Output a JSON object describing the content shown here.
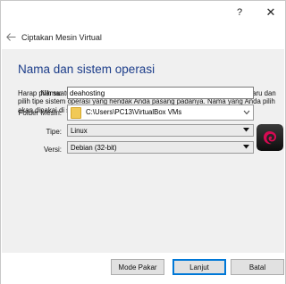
{
  "titlebar": {
    "help_label": "?",
    "close_label": "✕"
  },
  "nav": {
    "back_icon": "back-arrow-icon",
    "wizard_title": "Ciptakan Mesin Virtual"
  },
  "page": {
    "heading": "Nama dan sistem operasi",
    "description": "Harap pilih suatu nama yang deskriptif dan folder tujuan bagi mesin virtual baru dan pilih tipe sistem operasi yang hendak Anda pasang padanya. Nama yang Anda pilih akan dipakai di seluruh VirtualBox untuk mengidentifikasi mesin ini."
  },
  "form": {
    "name_label": "Nama:",
    "name_value": "deahosting",
    "folder_label": "Folder Mesin:",
    "folder_value": "C:\\Users\\PC13\\VirtualBox VMs",
    "type_label": "Tipe:",
    "type_value": "Linux",
    "version_label": "Versi:",
    "version_value": "Debian (32-bit)",
    "os_icon": "debian-icon"
  },
  "footer": {
    "expert_label": "Mode Pakar",
    "next_label": "Lanjut",
    "cancel_label": "Batal"
  },
  "colors": {
    "heading": "#1c3d8a",
    "accent": "#0078d7",
    "debian_red": "#d70a53"
  }
}
